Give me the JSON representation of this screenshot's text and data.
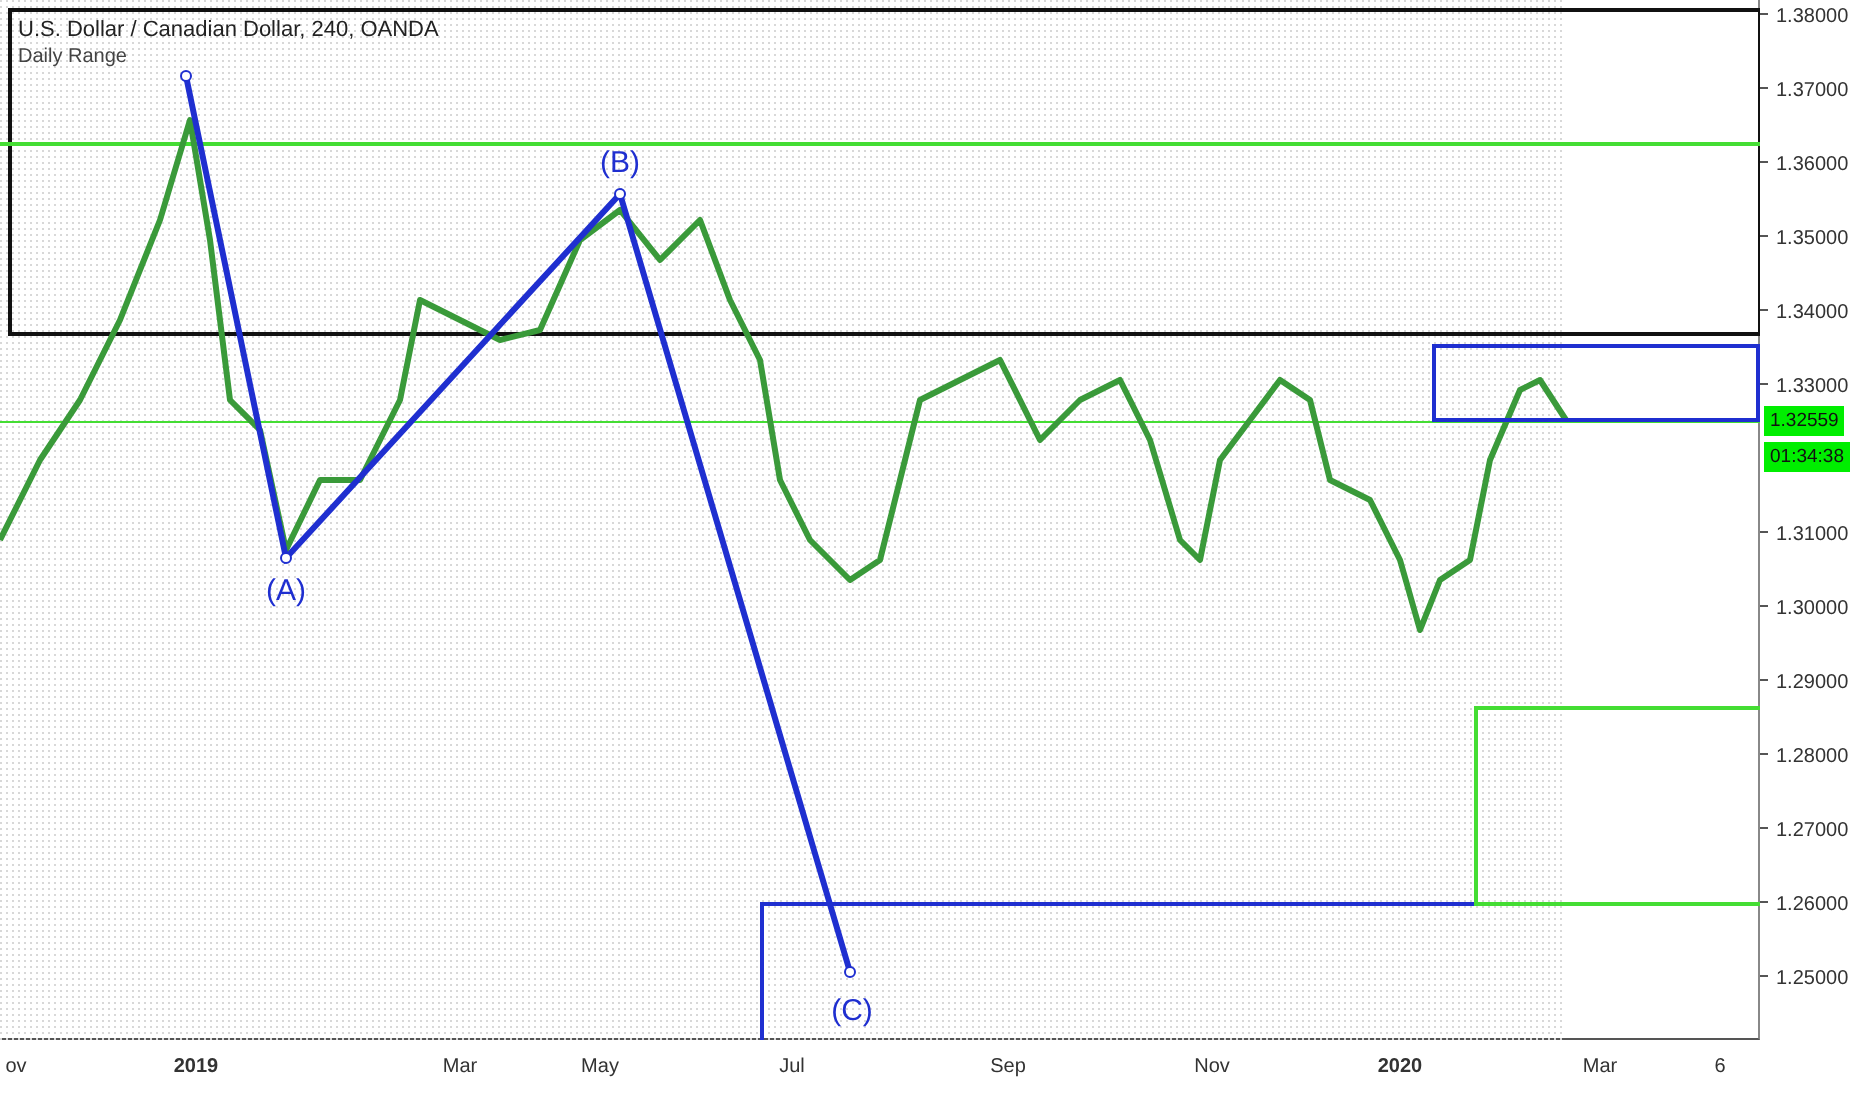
{
  "chart": {
    "title": "U.S. Dollar / Canadian Dollar, 240, OANDA",
    "indicator": "Daily Range",
    "wave_labels": [
      {
        "label": "(A)"
      },
      {
        "label": "(B)"
      },
      {
        "label": "(C)"
      }
    ]
  },
  "price_axis": {
    "labels": [
      "1.38000",
      "1.37000",
      "1.36000",
      "1.35000",
      "1.34000",
      "1.33000",
      "1.31000",
      "1.30000",
      "1.29000",
      "1.28000",
      "1.27000",
      "1.26000",
      "1.25000"
    ],
    "current_price": "1.32559",
    "countdown": "01:34:38"
  },
  "time_axis": {
    "labels": [
      "ov",
      "2019",
      "Mar",
      "May",
      "Jul",
      "Sep",
      "Nov",
      "2020",
      "Mar",
      "6"
    ]
  }
}
